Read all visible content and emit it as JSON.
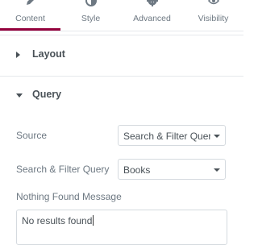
{
  "tabs": [
    {
      "label": "Content",
      "icon": "pencil-icon",
      "active": true
    },
    {
      "label": "Style",
      "icon": "half-circle-icon",
      "active": false
    },
    {
      "label": "Advanced",
      "icon": "gear-icon",
      "active": false
    },
    {
      "label": "Visibility",
      "icon": "eye-icon",
      "active": false
    }
  ],
  "sections": {
    "layout": {
      "title": "Layout",
      "expanded": false
    },
    "query": {
      "title": "Query",
      "expanded": true
    }
  },
  "controls": {
    "source": {
      "label": "Source",
      "value": "Search & Filter Query"
    },
    "sf_query": {
      "label": "Search & Filter Query",
      "value": "Books"
    },
    "nothing_found": {
      "label": "Nothing Found Message",
      "value": "No results found"
    }
  },
  "colors": {
    "accent": "#93003c",
    "text": "#495157",
    "border": "#d5dadf"
  }
}
